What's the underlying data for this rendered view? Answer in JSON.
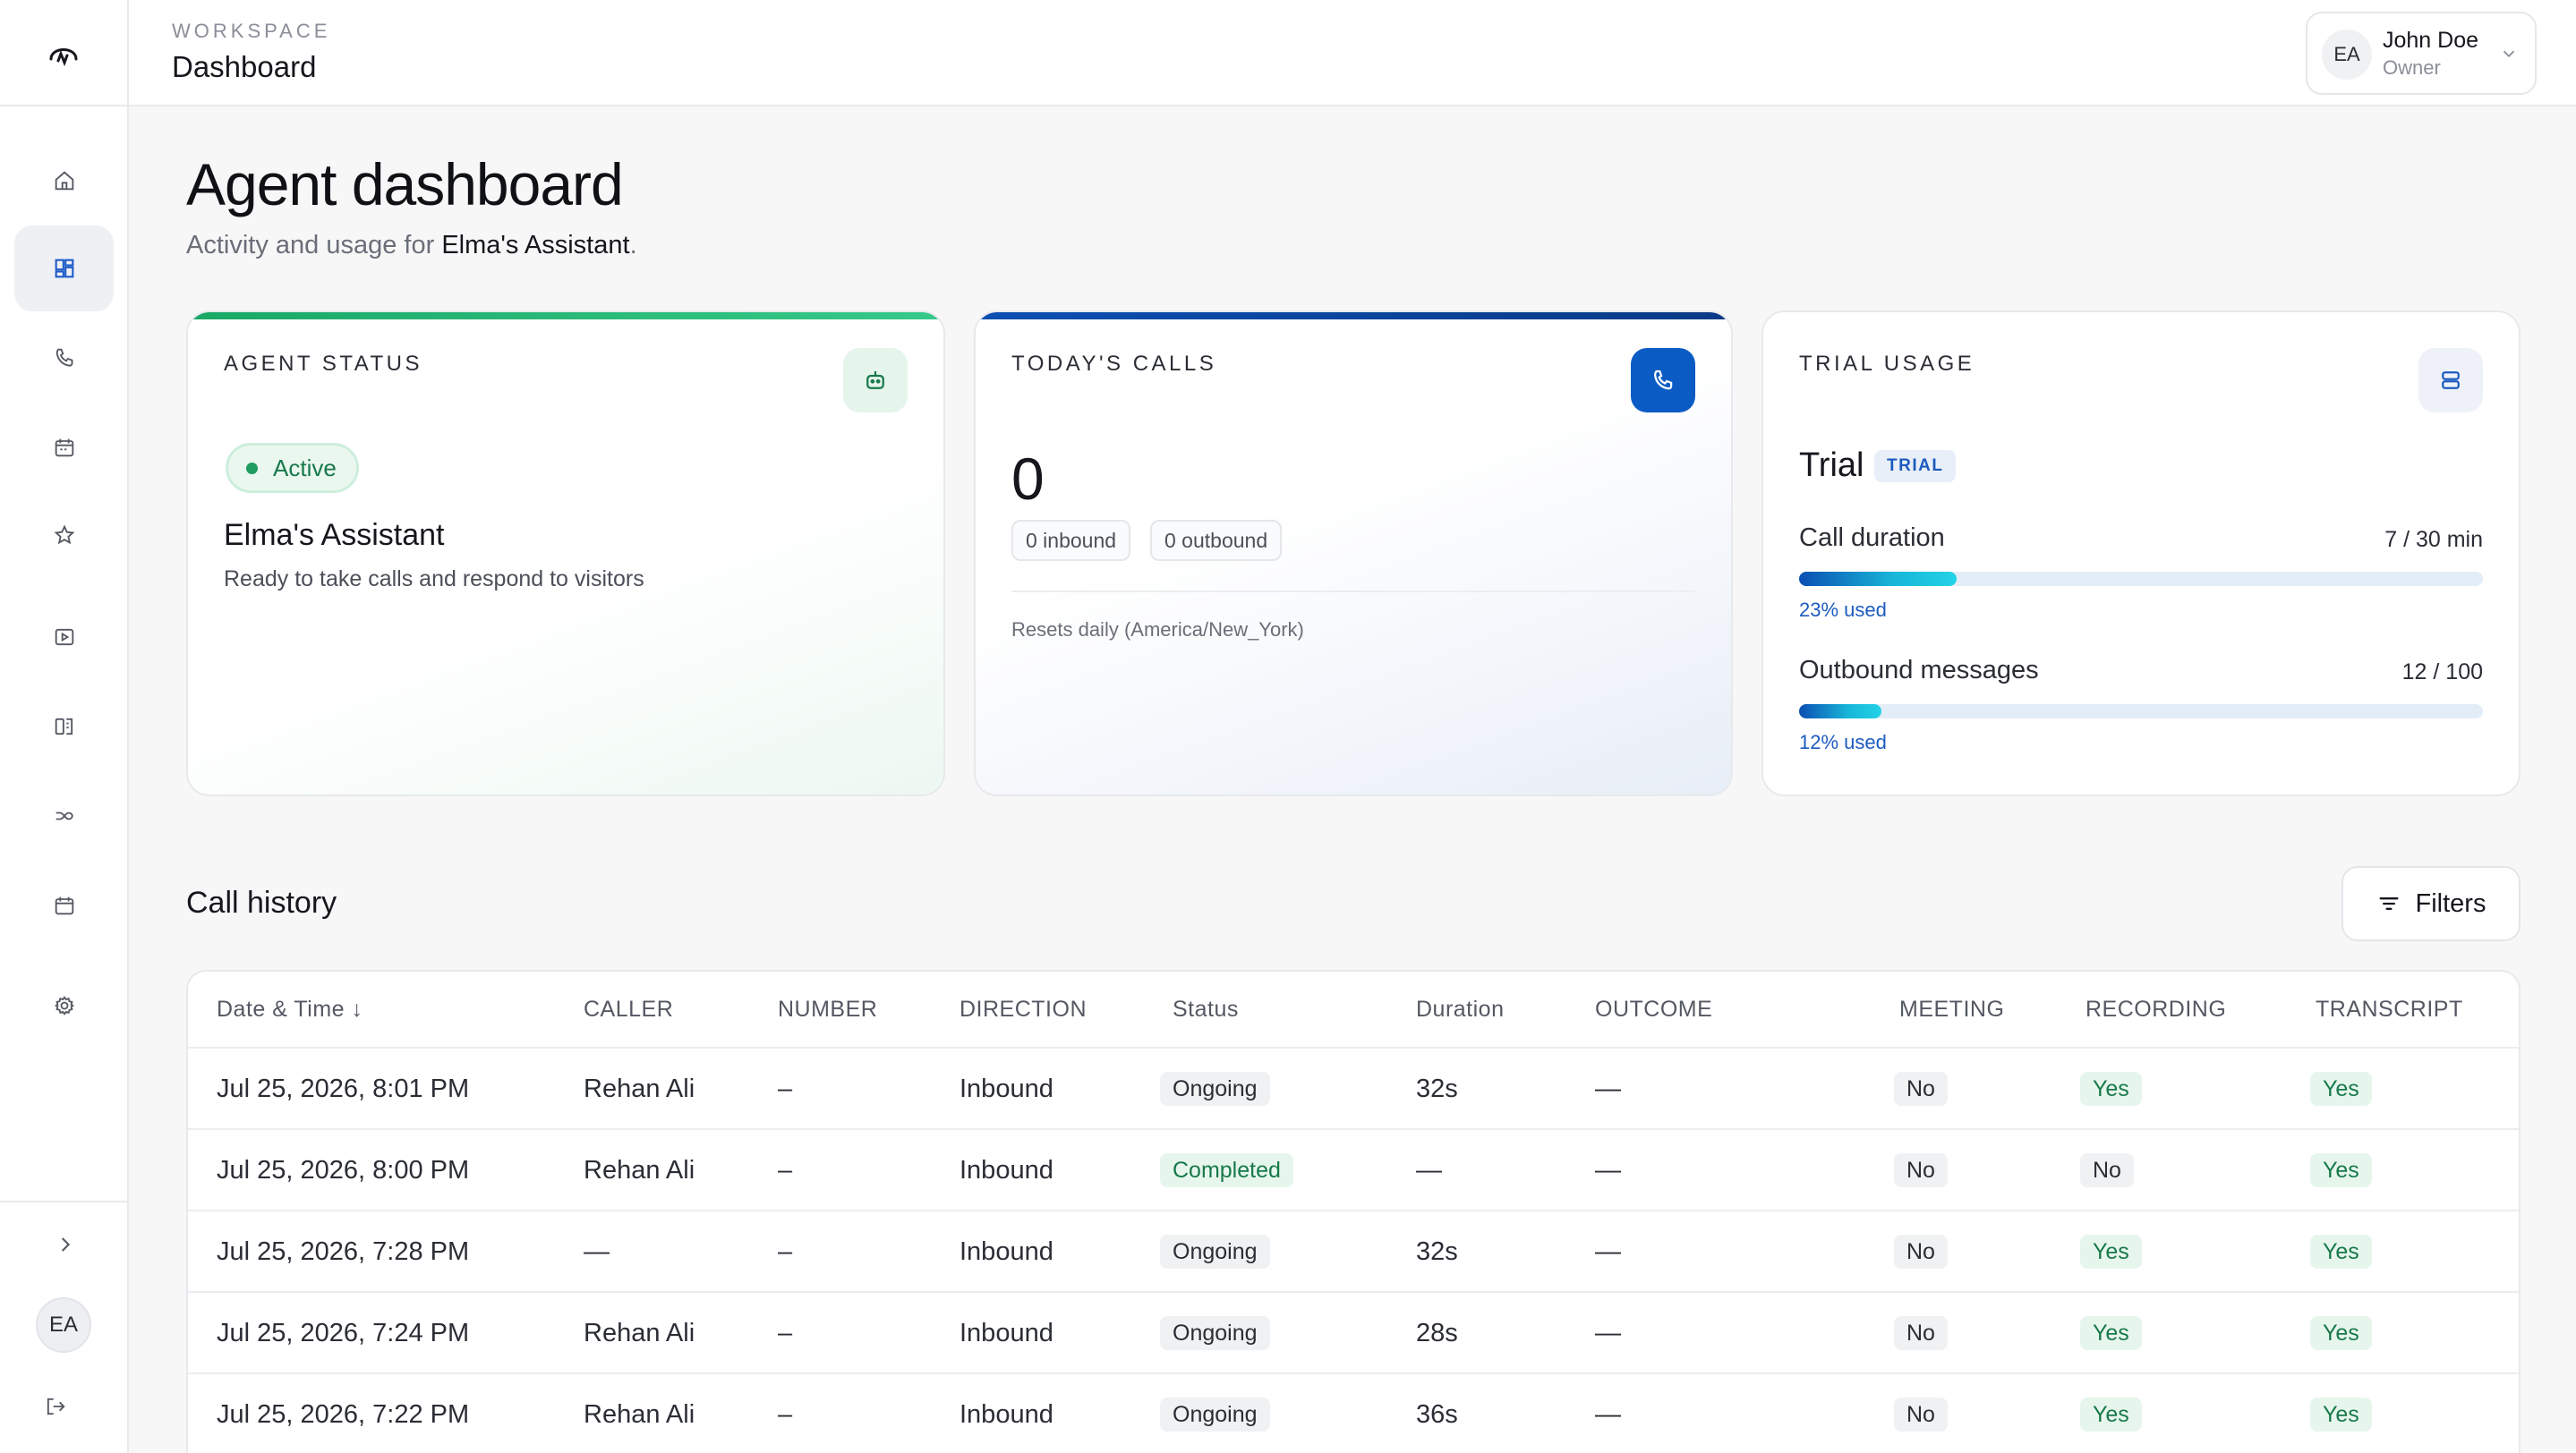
{
  "header": {
    "workspace_label": "WORKSPACE",
    "title": "Dashboard",
    "user": {
      "initials": "EA",
      "name": "John Doe",
      "role": "Owner"
    }
  },
  "sidebar": {
    "items": [
      {
        "icon": "home-icon"
      },
      {
        "icon": "dashboard-icon",
        "active": true
      },
      {
        "icon": "phone-icon"
      },
      {
        "icon": "calendar-icon"
      },
      {
        "icon": "star-icon"
      },
      {
        "icon": "play-icon"
      },
      {
        "icon": "book-icon"
      },
      {
        "icon": "integrations-icon"
      },
      {
        "icon": "calendar-alt-icon"
      },
      {
        "icon": "settings-icon"
      }
    ],
    "avatar_initials": "EA"
  },
  "page": {
    "title": "Agent dashboard",
    "subtitle_prefix": "Activity and usage for ",
    "subtitle_agent": "Elma's Assistant",
    "subtitle_suffix": "."
  },
  "agent_status": {
    "label": "AGENT STATUS",
    "status": "Active",
    "name": "Elma's Assistant",
    "description": "Ready to take calls and respond to visitors"
  },
  "todays_calls": {
    "label": "TODAY'S CALLS",
    "count": "0",
    "inbound": "0 inbound",
    "outbound": "0 outbound",
    "note": "Resets daily (America/New_York)"
  },
  "trial_usage": {
    "label": "TRIAL USAGE",
    "plan": "Trial",
    "badge": "TRIAL",
    "call_duration": {
      "label": "Call duration",
      "value": "7 / 30 min",
      "percent": 23,
      "used": "23% used"
    },
    "outbound_messages": {
      "label": "Outbound messages",
      "value": "12 / 100",
      "percent": 12,
      "used": "12% used"
    }
  },
  "call_history": {
    "title": "Call history",
    "filters_label": "Filters",
    "columns": [
      "Date & Time ↓",
      "CALLER",
      "NUMBER",
      "DIRECTION",
      "Status",
      "Duration",
      "OUTCOME",
      "MEETING",
      "RECORDING",
      "TRANSCRIPT"
    ],
    "rows": [
      {
        "date": "Jul 25, 2026, 8:01 PM",
        "caller": "Rehan Ali",
        "number": "–",
        "direction": "Inbound",
        "status": "Ongoing",
        "duration": "32s",
        "outcome": "—",
        "meeting": "No",
        "recording": "Yes",
        "transcript": "Yes"
      },
      {
        "date": "Jul 25, 2026, 8:00 PM",
        "caller": "Rehan Ali",
        "number": "–",
        "direction": "Inbound",
        "status": "Completed",
        "duration": "—",
        "outcome": "—",
        "meeting": "No",
        "recording": "No",
        "transcript": "Yes"
      },
      {
        "date": "Jul 25, 2026, 7:28 PM",
        "caller": "—",
        "number": "–",
        "direction": "Inbound",
        "status": "Ongoing",
        "duration": "32s",
        "outcome": "—",
        "meeting": "No",
        "recording": "Yes",
        "transcript": "Yes"
      },
      {
        "date": "Jul 25, 2026, 7:24 PM",
        "caller": "Rehan Ali",
        "number": "–",
        "direction": "Inbound",
        "status": "Ongoing",
        "duration": "28s",
        "outcome": "—",
        "meeting": "No",
        "recording": "Yes",
        "transcript": "Yes"
      },
      {
        "date": "Jul 25, 2026, 7:22 PM",
        "caller": "Rehan Ali",
        "number": "–",
        "direction": "Inbound",
        "status": "Ongoing",
        "duration": "36s",
        "outcome": "—",
        "meeting": "No",
        "recording": "Yes",
        "transcript": "Yes"
      }
    ]
  },
  "colors": {
    "accent": "#1d5bc9",
    "success": "#17794a",
    "agent_bar": "#22b573",
    "calls_bar": "#0b4fb3"
  }
}
